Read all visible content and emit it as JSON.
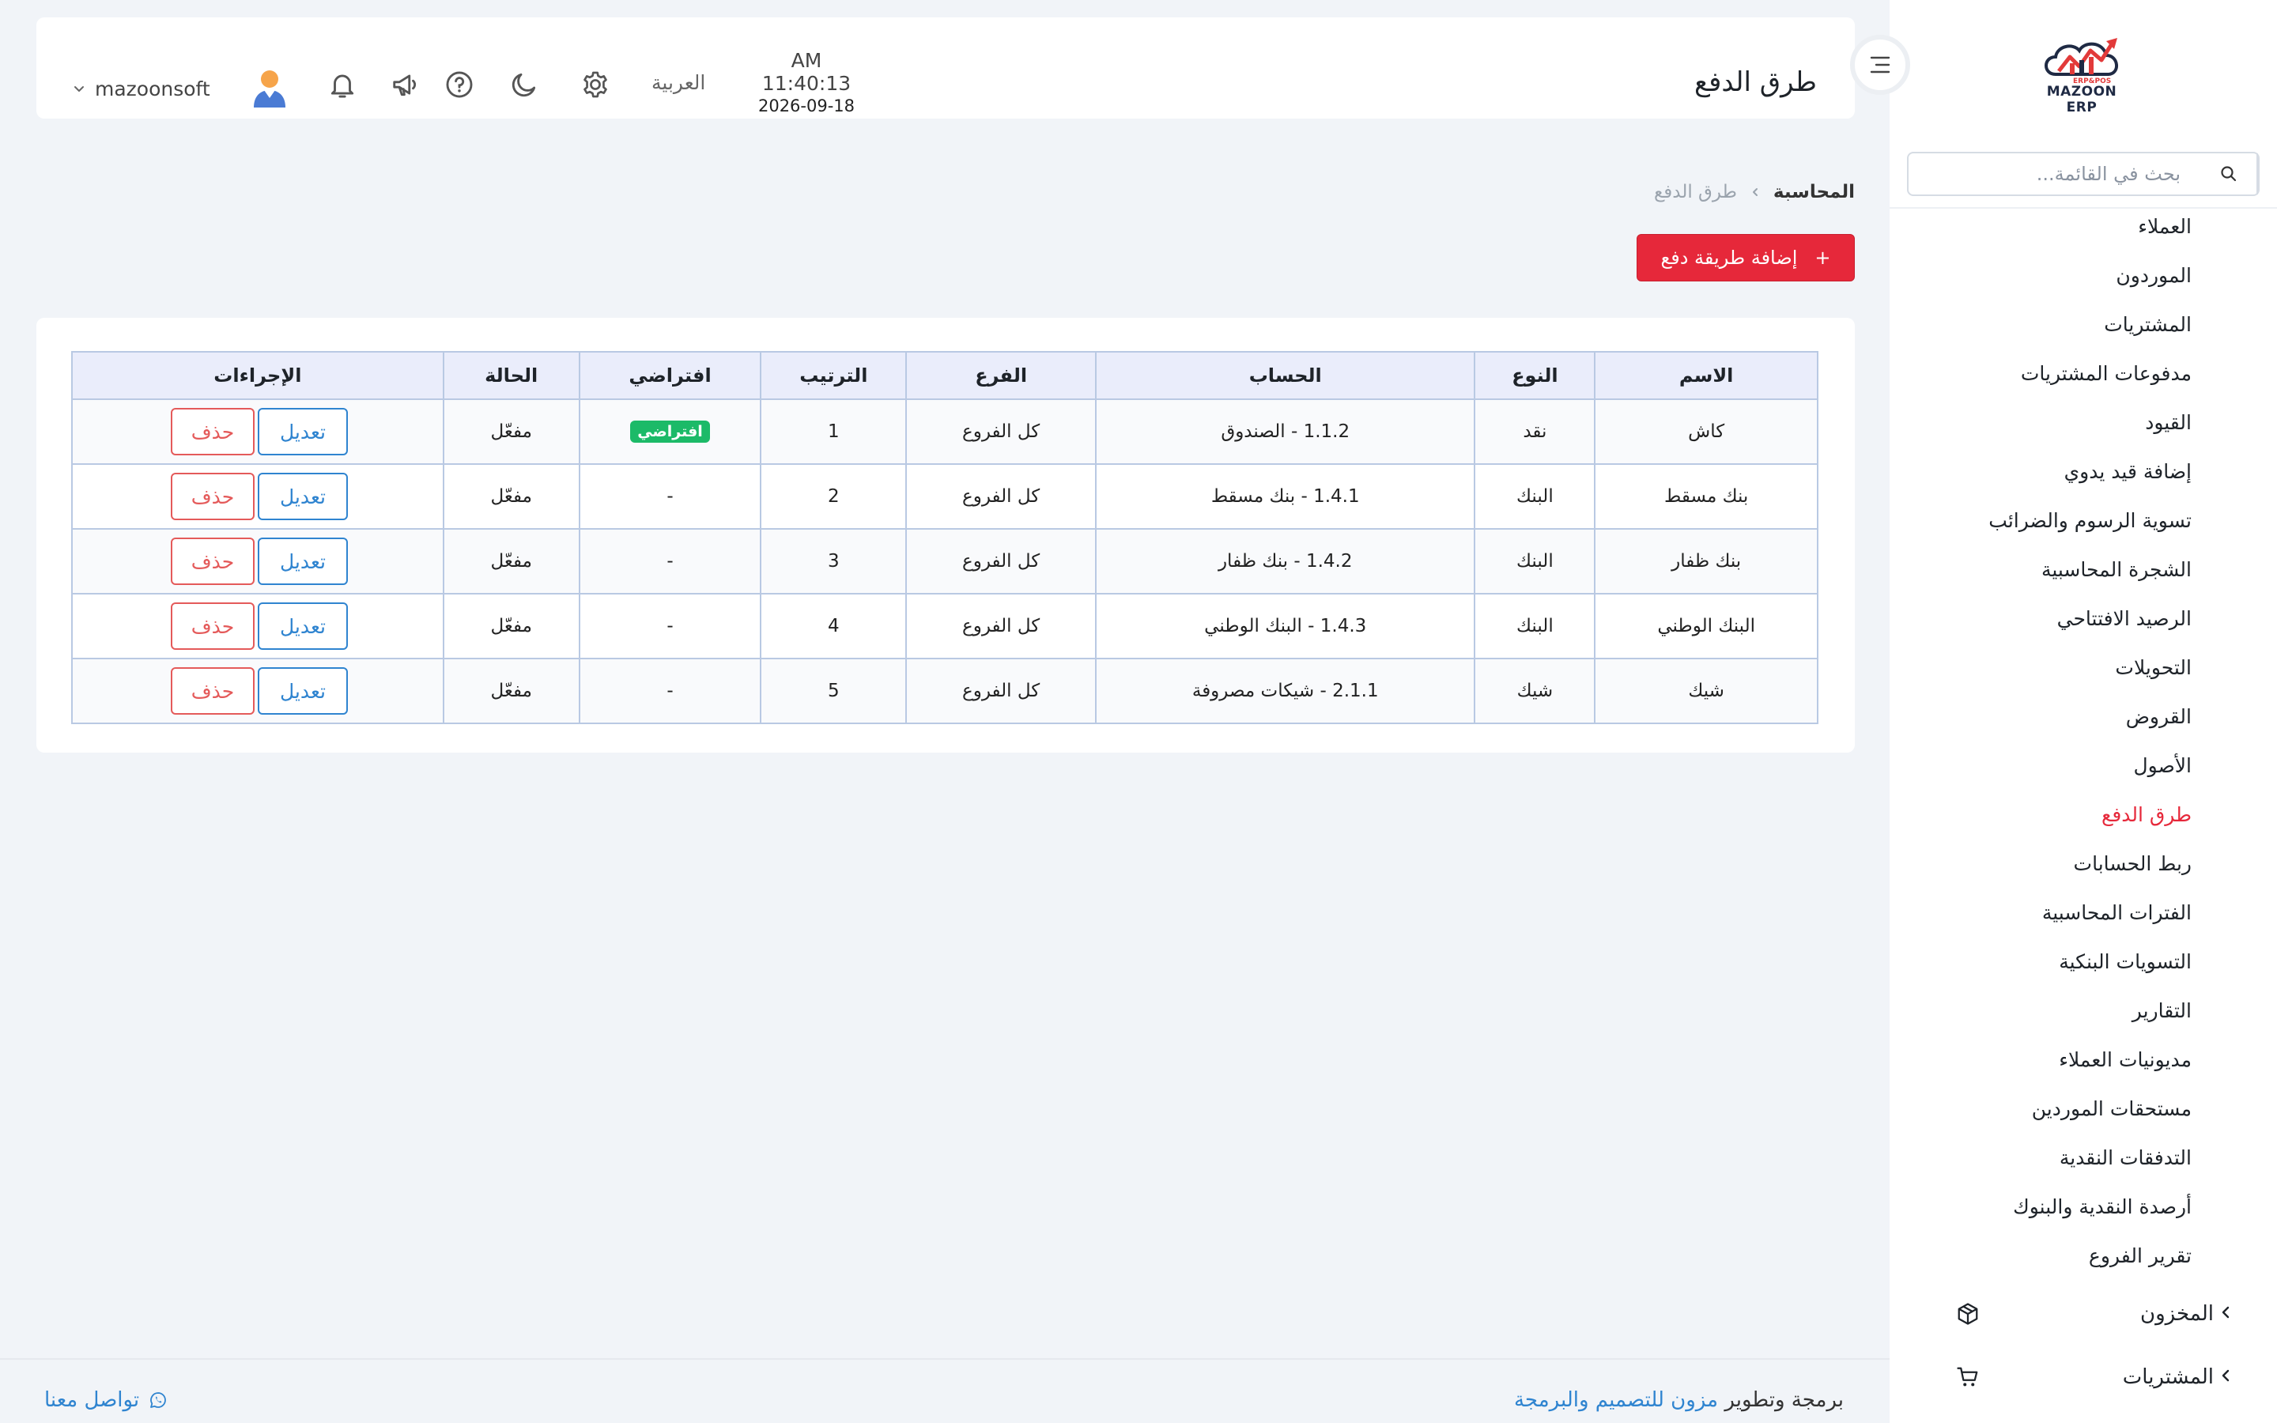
{
  "app": {
    "logo_text": "MAZOON ERP",
    "logo_sub": "ERP&POS"
  },
  "sidebar": {
    "search_placeholder": "بحث في القائمة...",
    "items": [
      {
        "label": "العملاء",
        "active": false
      },
      {
        "label": "الموردون",
        "active": false
      },
      {
        "label": "المشتريات",
        "active": false
      },
      {
        "label": "مدفوعات المشتريات",
        "active": false
      },
      {
        "label": "القيود",
        "active": false
      },
      {
        "label": "إضافة قيد يدوي",
        "active": false
      },
      {
        "label": "تسوية الرسوم والضرائب",
        "active": false
      },
      {
        "label": "الشجرة المحاسبية",
        "active": false
      },
      {
        "label": "الرصيد الافتتاحي",
        "active": false
      },
      {
        "label": "التحويلات",
        "active": false
      },
      {
        "label": "القروض",
        "active": false
      },
      {
        "label": "الأصول",
        "active": false
      },
      {
        "label": "طرق الدفع",
        "active": true
      },
      {
        "label": "ربط الحسابات",
        "active": false
      },
      {
        "label": "الفترات المحاسبية",
        "active": false
      },
      {
        "label": "التسويات البنكية",
        "active": false
      },
      {
        "label": "التقارير",
        "active": false
      },
      {
        "label": "مديونيات العملاء",
        "active": false
      },
      {
        "label": "مستحقات الموردين",
        "active": false
      },
      {
        "label": "التدفقات النقدية",
        "active": false
      },
      {
        "label": "أرصدة النقدية والبنوك",
        "active": false
      },
      {
        "label": "تقرير الفروع",
        "active": false
      }
    ],
    "groups": [
      {
        "label": "المخزون",
        "icon": "box-icon"
      },
      {
        "label": "المشتريات",
        "icon": "cart-icon"
      }
    ]
  },
  "header": {
    "title": "طرق الدفع",
    "time": "AM 11:40:13",
    "date": "2026-09-18",
    "language": "العربية",
    "username": "mazoonsoft"
  },
  "breadcrumb": {
    "root": "المحاسبة",
    "current": "طرق الدفع"
  },
  "add_button": {
    "label": "إضافة طريقة دفع",
    "icon": "+"
  },
  "table": {
    "headers": [
      "الاسم",
      "النوع",
      "الحساب",
      "الفرع",
      "الترتيب",
      "افتراضي",
      "الحالة",
      "الإجراءات"
    ],
    "rows": [
      {
        "name": "كاش",
        "type": "نقد",
        "account": "1.1.2 - الصندوق",
        "branch": "كل الفروع",
        "order": "1",
        "default": "افتراضي",
        "is_default": true,
        "status": "مفعّل"
      },
      {
        "name": "بنك مسقط",
        "type": "البنك",
        "account": "1.4.1 - بنك مسقط",
        "branch": "كل الفروع",
        "order": "2",
        "default": "-",
        "is_default": false,
        "status": "مفعّل"
      },
      {
        "name": "بنك ظفار",
        "type": "البنك",
        "account": "1.4.2 - بنك ظفار",
        "branch": "كل الفروع",
        "order": "3",
        "default": "-",
        "is_default": false,
        "status": "مفعّل"
      },
      {
        "name": "البنك الوطني",
        "type": "البنك",
        "account": "1.4.3 - البنك الوطني",
        "branch": "كل الفروع",
        "order": "4",
        "default": "-",
        "is_default": false,
        "status": "مفعّل"
      },
      {
        "name": "شيك",
        "type": "شيك",
        "account": "2.1.1 - شيكات مصروفة",
        "branch": "كل الفروع",
        "order": "5",
        "default": "-",
        "is_default": false,
        "status": "مفعّل"
      }
    ],
    "edit_label": "تعديل",
    "delete_label": "حذف"
  },
  "footer": {
    "credit_prefix": "برمجة وتطوير",
    "credit_link": "مزون للتصميم والبرمجة",
    "contact": "تواصل معنا"
  },
  "colors": {
    "accent": "#e6283a",
    "link": "#2f84d0",
    "badge": "#1cba68",
    "background": "#f1f4f8"
  }
}
